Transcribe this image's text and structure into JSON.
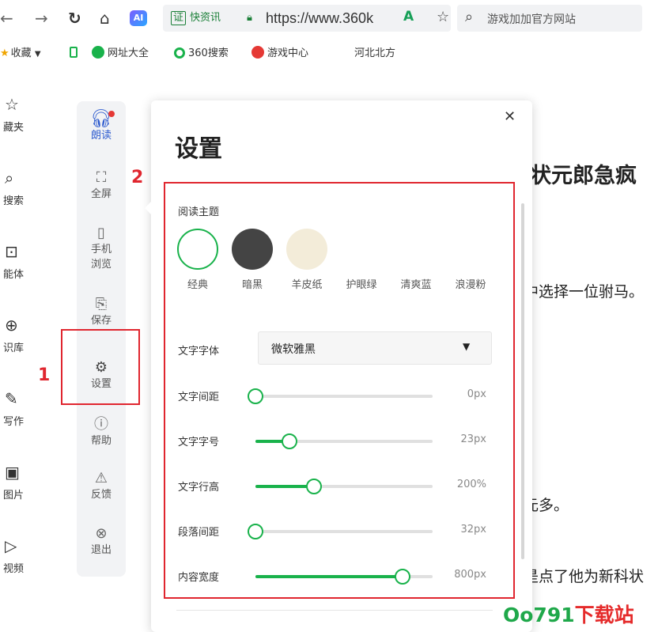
{
  "toolbar": {
    "addr_badge": "证",
    "addr_badge_text": "快资讯",
    "url": "https://www.360k",
    "search_placeholder": "游戏加加官方网站",
    "icons": [
      "back-icon",
      "forward-icon",
      "refresh-icon",
      "home-icon",
      "ai-icon",
      "lock-icon",
      "read-aloud-icon",
      "star-icon",
      "search-icon"
    ]
  },
  "bookmarks": {
    "items": [
      {
        "label": "收藏",
        "icon": "star-icon"
      },
      {
        "label": "",
        "icon": "mobile-icon"
      },
      {
        "label": "网址大全",
        "icon": "site-nav-icon"
      },
      {
        "label": "360搜索",
        "icon": "search-logo-icon"
      },
      {
        "label": "游戏中心",
        "icon": "game-icon"
      },
      {
        "label": "河北北方",
        "icon": ""
      }
    ]
  },
  "leftbar": {
    "items": [
      {
        "label": "藏夹",
        "icon": "star-icon"
      },
      {
        "label": "搜索",
        "icon": "search-icon"
      },
      {
        "label": "能体",
        "icon": "agent-icon"
      },
      {
        "label": "识库",
        "icon": "knowledge-icon"
      },
      {
        "label": "写作",
        "icon": "pen-icon"
      },
      {
        "label": "图片",
        "icon": "image-icon"
      },
      {
        "label": "视频",
        "icon": "video-icon"
      }
    ]
  },
  "article": {
    "headline": "状元郎急疯",
    "line1": "中选择一位驸马。",
    "line2": "元多。",
    "line3": "是点了他为新科状"
  },
  "toolcol": {
    "items": [
      {
        "label": "朗读",
        "icon": "headphones-icon"
      },
      {
        "label": "全屏",
        "icon": "fullscreen-icon"
      },
      {
        "label": "手机\n浏览",
        "label1": "手机",
        "label2": "浏览",
        "icon": "phone-icon"
      },
      {
        "label": "保存",
        "icon": "save-icon"
      },
      {
        "label": "设置",
        "icon": "gear-icon"
      },
      {
        "label": "帮助",
        "icon": "help-icon"
      },
      {
        "label": "反馈",
        "icon": "feedback-icon"
      },
      {
        "label": "退出",
        "icon": "exit-icon"
      }
    ]
  },
  "annotations": {
    "one": "1",
    "two": "2",
    "color": "#e0262f"
  },
  "panel": {
    "title": "设置",
    "theme_label": "阅读主题",
    "themes": [
      {
        "label": "经典",
        "color": "#ffffff",
        "selected": true
      },
      {
        "label": "暗黑",
        "color": "#444444"
      },
      {
        "label": "羊皮纸",
        "color": "#f3ecd9"
      },
      {
        "label": "护眼绿",
        "color": "#ffffff"
      },
      {
        "label": "清爽蓝",
        "color": "#ffffff"
      },
      {
        "label": "浪漫粉",
        "color": "#ffffff"
      }
    ],
    "font_label": "文字字体",
    "font_value": "微软雅黑",
    "sliders": [
      {
        "label": "文字间距",
        "value_text": "0px",
        "fraction": 0.0
      },
      {
        "label": "文字字号",
        "value_text": "23px",
        "fraction": 0.19
      },
      {
        "label": "文字行高",
        "value_text": "200%",
        "fraction": 0.33
      },
      {
        "label": "段落间距",
        "value_text": "32px",
        "fraction": 0.0
      },
      {
        "label": "内容宽度",
        "value_text": "800px",
        "fraction": 0.83
      }
    ],
    "accent": "#19b24b"
  },
  "watermark": {
    "green": "Oo791",
    "red": "下载站"
  }
}
